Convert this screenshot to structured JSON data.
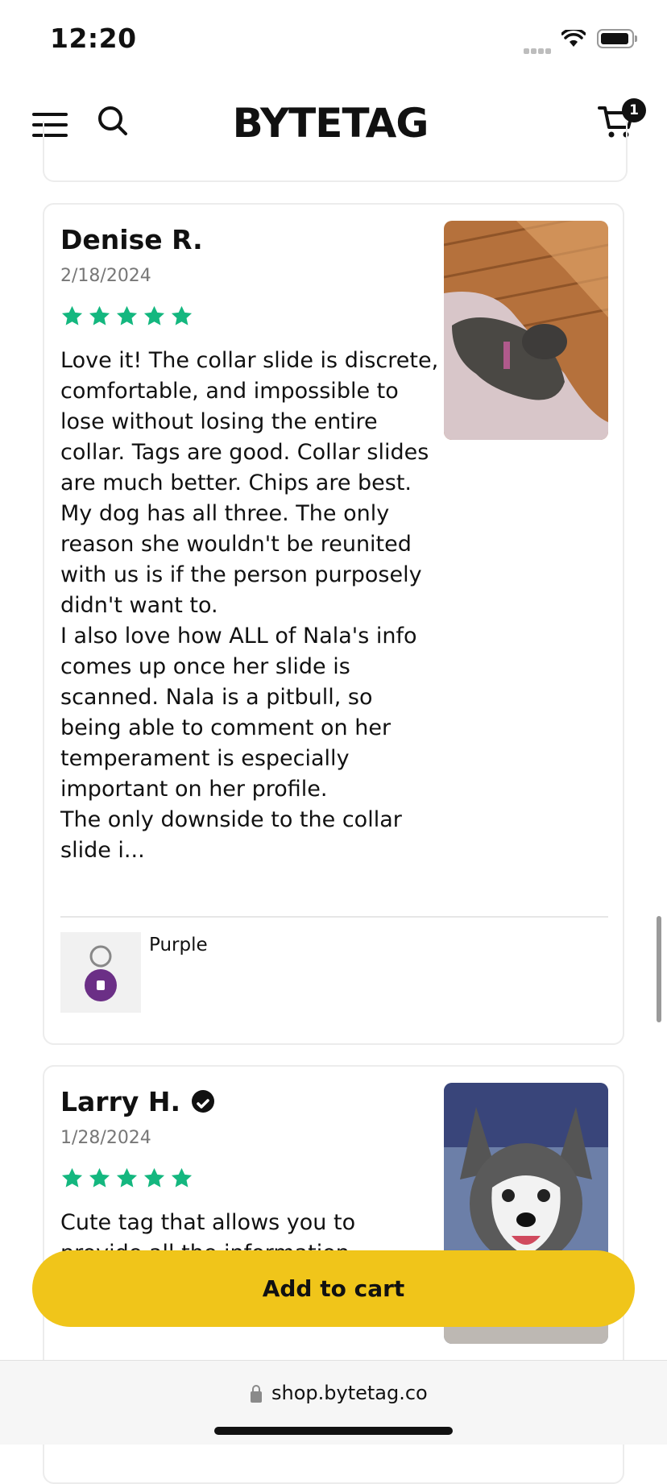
{
  "status_bar": {
    "time": "12:20"
  },
  "header": {
    "logo": "BYTETAG",
    "cart_count": "1"
  },
  "reviews": [
    {
      "name": "Denise R.",
      "date": "2/18/2024",
      "rating": 5,
      "text": "Love it! The collar slide is discrete, comfortable, and impossible to lose without losing the entire collar. Tags are good. Collar slides are much better. Chips are best. My dog has all three. The only reason she wouldn't be reunited with us is if the person purposely didn't want to.\nI also love how ALL of Nala's info comes up once her slide is scanned. Nala is a pitbull, so being able to comment on her temperament is especially important on her profile.\nThe only downside to the collar slide i...",
      "variant": "Purple",
      "verified": false
    },
    {
      "name": "Larry H.",
      "date": "1/28/2024",
      "rating": 5,
      "text": "Cute tag that allows you to provide all the information\nnever have to use it, but if we do",
      "verified": true
    }
  ],
  "cta": {
    "label": "Add to cart"
  },
  "browser": {
    "url": "shop.bytetag.co"
  },
  "colors": {
    "accent": "#f0c51a",
    "star": "#14b77f"
  }
}
